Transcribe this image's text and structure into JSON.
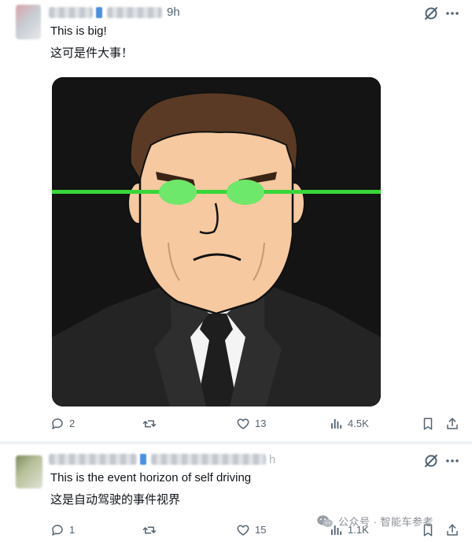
{
  "post1": {
    "time": "9h",
    "text_en": "This is big!",
    "text_zh": "这可是件大事！",
    "actions": {
      "replies": "2",
      "reposts": "",
      "likes": "13",
      "views": "4.5K"
    }
  },
  "post2": {
    "time_partial": "h",
    "text_en": "This is the event horizon of self driving",
    "text_zh": "这是自动驾驶的事件视界",
    "actions": {
      "replies": "1",
      "reposts": "",
      "likes": "15",
      "views": "1.1K"
    }
  },
  "watermark": {
    "text": "公众号 · 智能车参考"
  },
  "colors": {
    "icon_gray": "#536471",
    "laser_green": "#38d63a",
    "eye_green": "#6de86a",
    "skin": "#f6c9a0",
    "hair": "#5a3a24",
    "suit": "#242424",
    "shirt": "#f5f5f5",
    "verified_blue": "#4a90e2"
  },
  "icons": [
    "grok-slash-icon",
    "more-icon",
    "reply-icon",
    "repost-icon",
    "like-icon",
    "views-icon",
    "bookmark-icon",
    "share-icon",
    "wechat-icon"
  ]
}
